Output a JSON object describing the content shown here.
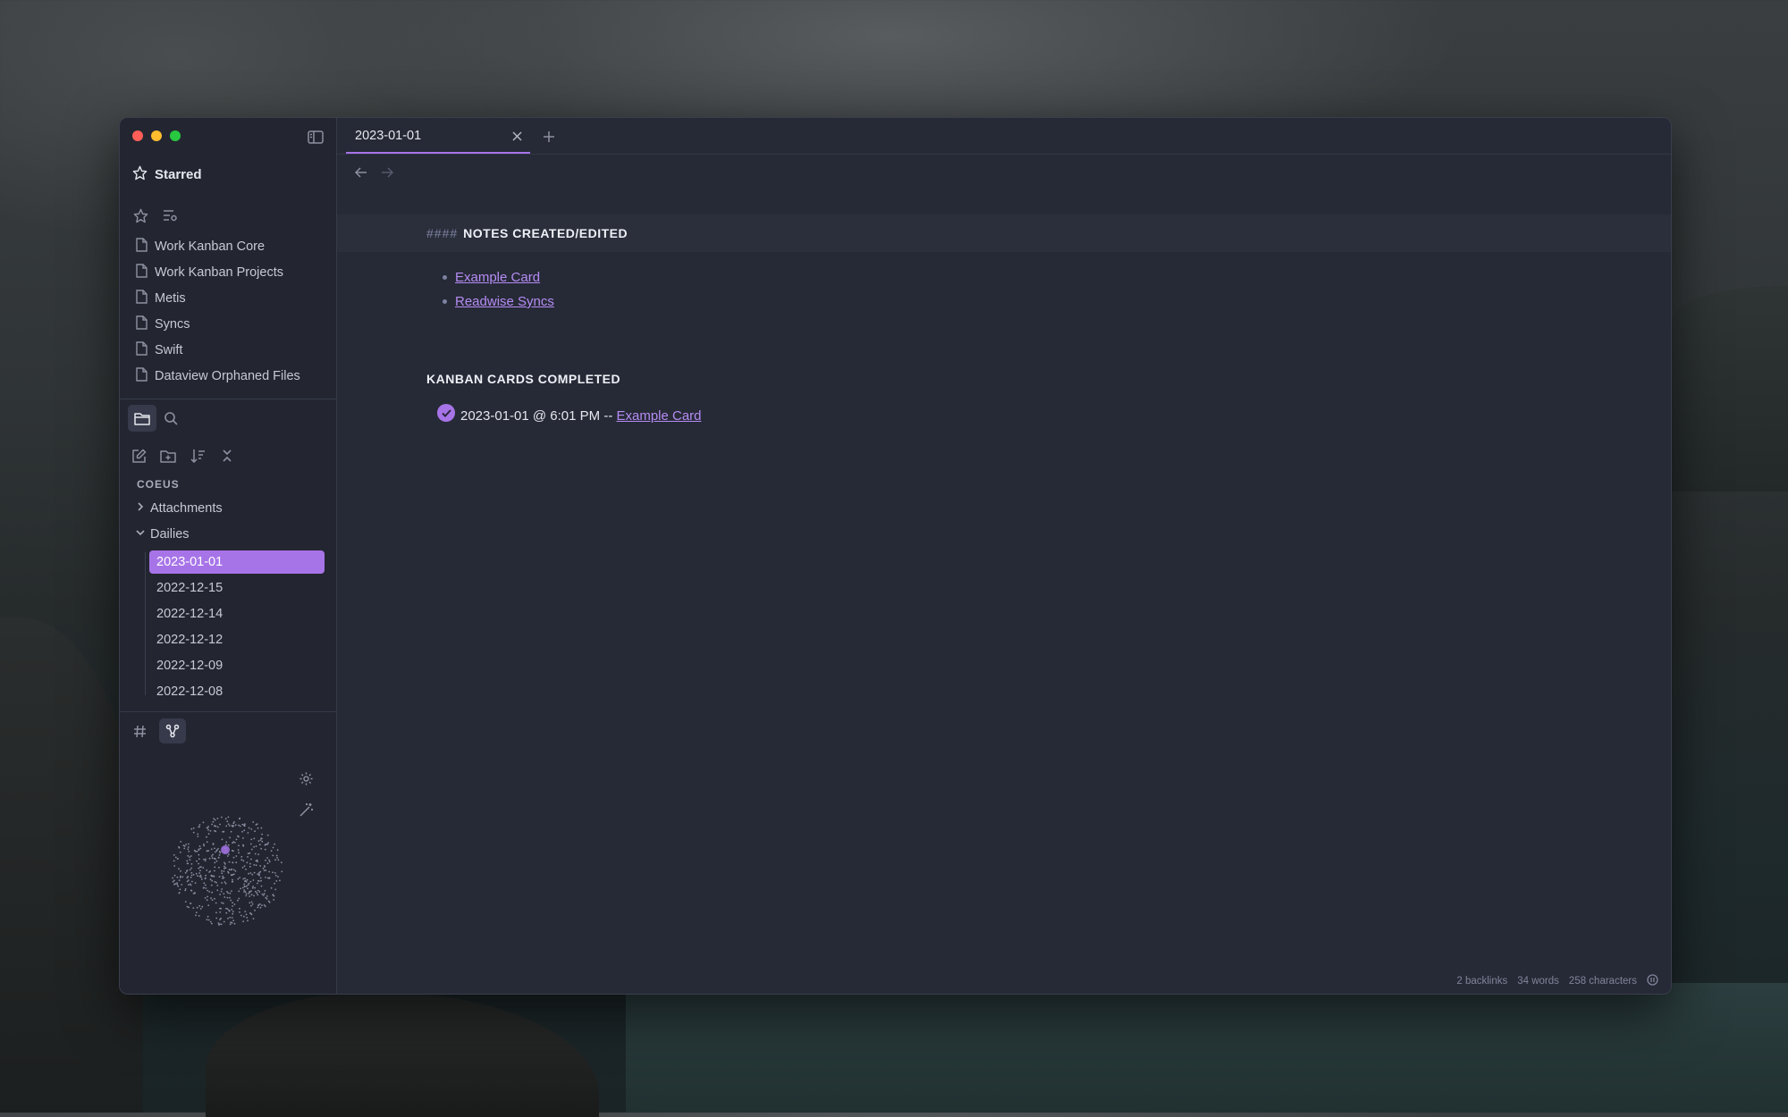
{
  "window": {
    "accent_color": "#a774e8",
    "link_color": "#b68cf5"
  },
  "sidebar": {
    "starred": {
      "title": "Starred",
      "items": [
        {
          "label": "Work Kanban Core"
        },
        {
          "label": "Work Kanban Projects"
        },
        {
          "label": "Metis"
        },
        {
          "label": "Syncs"
        },
        {
          "label": "Swift"
        },
        {
          "label": "Dataview Orphaned Files"
        }
      ]
    },
    "explorer": {
      "vault_name": "COEUS",
      "folders": [
        {
          "label": "Attachments",
          "expanded": false
        },
        {
          "label": "Dailies",
          "expanded": true
        }
      ],
      "dailies": [
        {
          "label": "2023-01-01",
          "active": true
        },
        {
          "label": "2022-12-15",
          "active": false
        },
        {
          "label": "2022-12-14",
          "active": false
        },
        {
          "label": "2022-12-12",
          "active": false
        },
        {
          "label": "2022-12-09",
          "active": false
        },
        {
          "label": "2022-12-08",
          "active": false
        }
      ]
    },
    "icons": [
      "sidebar-toggle-icon",
      "star-icon",
      "star-outline-icon",
      "list-settings-icon",
      "folder-icon",
      "search-icon",
      "new-note-icon",
      "new-folder-icon",
      "sort-icon",
      "collapse-all-icon",
      "hash-icon",
      "graph-icon",
      "gear-icon",
      "magic-wand-icon"
    ]
  },
  "tabs": [
    {
      "title": "2023-01-01",
      "active": true
    }
  ],
  "note": {
    "heading1_marks": "####",
    "heading1_text": "NOTES CREATED/EDITED",
    "links": [
      {
        "label": "Example Card"
      },
      {
        "label": "Readwise Syncs"
      }
    ],
    "heading2_text": "KANBAN CARDS COMPLETED",
    "completed": {
      "text": "2023-01-01 @ 6:01 PM -- ",
      "link": "Example Card"
    }
  },
  "status": {
    "backlinks": "2 backlinks",
    "words": "34 words",
    "characters": "258 characters"
  }
}
